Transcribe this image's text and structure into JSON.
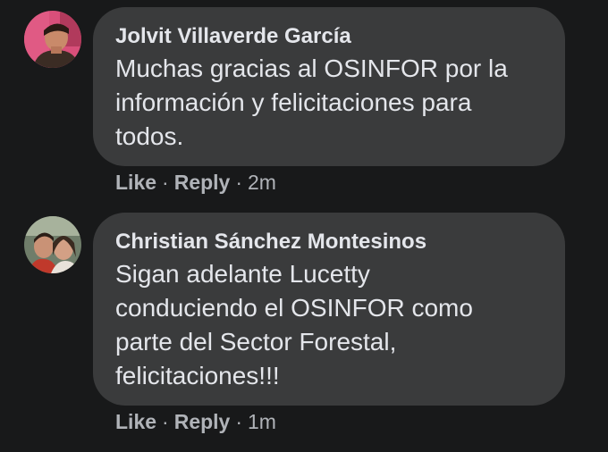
{
  "comments": [
    {
      "author": "Jolvit Villaverde García",
      "lines": [
        "Muchas gracias al OSINFOR por la",
        "información y felicitaciones para",
        "todos."
      ],
      "like_label": "Like",
      "reply_label": "Reply",
      "separator": "·",
      "time": "2m"
    },
    {
      "author": "Christian Sánchez Montesinos",
      "lines": [
        "Sigan adelante Lucetty",
        "conduciendo el OSINFOR como",
        "parte del Sector Forestal,",
        "felicitaciones!!!"
      ],
      "like_label": "Like",
      "reply_label": "Reply",
      "separator": "·",
      "time": "1m"
    }
  ],
  "colors": {
    "background": "#18191a",
    "bubble": "#3a3b3c",
    "primary_text": "#e4e6eb",
    "secondary_text": "#b0b3b8"
  }
}
